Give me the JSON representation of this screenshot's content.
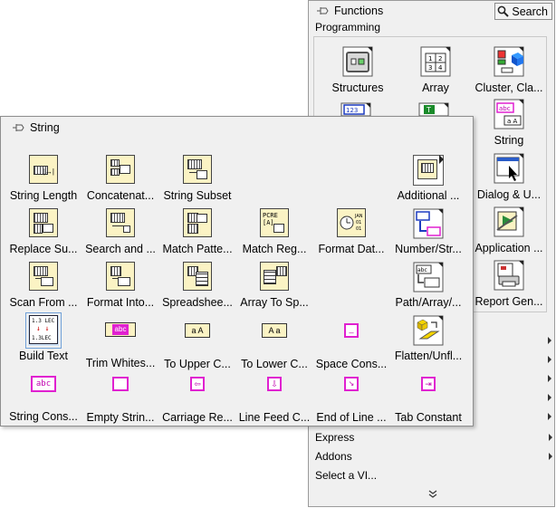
{
  "functions": {
    "title": "Functions",
    "search_label": "Search",
    "category": "Programming",
    "items": [
      {
        "label": "Structures"
      },
      {
        "label": "Array"
      },
      {
        "label": "Cluster, Cla..."
      },
      {
        "label": "String"
      },
      {
        "label": "Dialog & U..."
      },
      {
        "label": "Application ..."
      },
      {
        "label": "Report Gen..."
      }
    ],
    "menu": [
      {
        "label": "Express"
      },
      {
        "label": "Addons"
      },
      {
        "label": "Select a VI..."
      }
    ]
  },
  "string_palette": {
    "title": "String",
    "items": [
      {
        "label": "String Length"
      },
      {
        "label": "Concatenat..."
      },
      {
        "label": "String Subset"
      },
      {
        "label": "Additional ..."
      },
      {
        "label": "Replace Su..."
      },
      {
        "label": "Search and ..."
      },
      {
        "label": "Match Patte..."
      },
      {
        "label": "Match Reg..."
      },
      {
        "label": "Format Dat..."
      },
      {
        "label": "Number/Str..."
      },
      {
        "label": "Scan From ..."
      },
      {
        "label": "Format Into..."
      },
      {
        "label": "Spreadshee..."
      },
      {
        "label": "Array To Sp..."
      },
      {
        "label": "Path/Array/..."
      },
      {
        "label": "Build Text"
      },
      {
        "label": "Trim Whites..."
      },
      {
        "label": "To Upper C..."
      },
      {
        "label": "To Lower C..."
      },
      {
        "label": "Space Cons..."
      },
      {
        "label": "Flatten/Unfl..."
      },
      {
        "label": "String Cons..."
      },
      {
        "label": "Empty Strin..."
      },
      {
        "label": "Carriage Re..."
      },
      {
        "label": "Line Feed C..."
      },
      {
        "label": "End of Line ..."
      },
      {
        "label": "Tab Constant"
      }
    ],
    "icon_text": {
      "abc": "abc",
      "aa_upper": "a A",
      "aa_lower": "A a",
      "num": "123",
      "build_top": "1.3 LEC",
      "build_bot": "1.3LEC",
      "fmt_date": "JAN 01 01",
      "match_reg": "PCRE [A]"
    }
  }
}
